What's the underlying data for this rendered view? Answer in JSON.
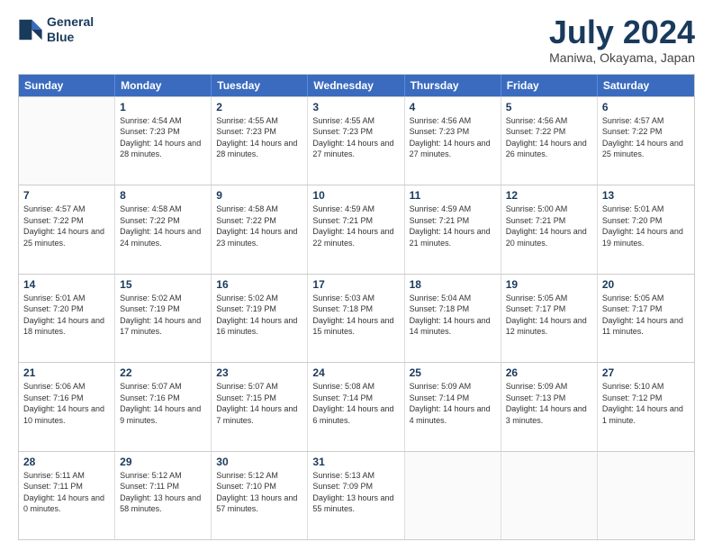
{
  "header": {
    "logo_line1": "General",
    "logo_line2": "Blue",
    "title": "July 2024",
    "subtitle": "Maniwa, Okayama, Japan"
  },
  "calendar": {
    "days": [
      "Sunday",
      "Monday",
      "Tuesday",
      "Wednesday",
      "Thursday",
      "Friday",
      "Saturday"
    ],
    "weeks": [
      [
        {
          "day": "",
          "sunrise": "",
          "sunset": "",
          "daylight": ""
        },
        {
          "day": "1",
          "sunrise": "Sunrise: 4:54 AM",
          "sunset": "Sunset: 7:23 PM",
          "daylight": "Daylight: 14 hours and 28 minutes."
        },
        {
          "day": "2",
          "sunrise": "Sunrise: 4:55 AM",
          "sunset": "Sunset: 7:23 PM",
          "daylight": "Daylight: 14 hours and 28 minutes."
        },
        {
          "day": "3",
          "sunrise": "Sunrise: 4:55 AM",
          "sunset": "Sunset: 7:23 PM",
          "daylight": "Daylight: 14 hours and 27 minutes."
        },
        {
          "day": "4",
          "sunrise": "Sunrise: 4:56 AM",
          "sunset": "Sunset: 7:23 PM",
          "daylight": "Daylight: 14 hours and 27 minutes."
        },
        {
          "day": "5",
          "sunrise": "Sunrise: 4:56 AM",
          "sunset": "Sunset: 7:22 PM",
          "daylight": "Daylight: 14 hours and 26 minutes."
        },
        {
          "day": "6",
          "sunrise": "Sunrise: 4:57 AM",
          "sunset": "Sunset: 7:22 PM",
          "daylight": "Daylight: 14 hours and 25 minutes."
        }
      ],
      [
        {
          "day": "7",
          "sunrise": "Sunrise: 4:57 AM",
          "sunset": "Sunset: 7:22 PM",
          "daylight": "Daylight: 14 hours and 25 minutes."
        },
        {
          "day": "8",
          "sunrise": "Sunrise: 4:58 AM",
          "sunset": "Sunset: 7:22 PM",
          "daylight": "Daylight: 14 hours and 24 minutes."
        },
        {
          "day": "9",
          "sunrise": "Sunrise: 4:58 AM",
          "sunset": "Sunset: 7:22 PM",
          "daylight": "Daylight: 14 hours and 23 minutes."
        },
        {
          "day": "10",
          "sunrise": "Sunrise: 4:59 AM",
          "sunset": "Sunset: 7:21 PM",
          "daylight": "Daylight: 14 hours and 22 minutes."
        },
        {
          "day": "11",
          "sunrise": "Sunrise: 4:59 AM",
          "sunset": "Sunset: 7:21 PM",
          "daylight": "Daylight: 14 hours and 21 minutes."
        },
        {
          "day": "12",
          "sunrise": "Sunrise: 5:00 AM",
          "sunset": "Sunset: 7:21 PM",
          "daylight": "Daylight: 14 hours and 20 minutes."
        },
        {
          "day": "13",
          "sunrise": "Sunrise: 5:01 AM",
          "sunset": "Sunset: 7:20 PM",
          "daylight": "Daylight: 14 hours and 19 minutes."
        }
      ],
      [
        {
          "day": "14",
          "sunrise": "Sunrise: 5:01 AM",
          "sunset": "Sunset: 7:20 PM",
          "daylight": "Daylight: 14 hours and 18 minutes."
        },
        {
          "day": "15",
          "sunrise": "Sunrise: 5:02 AM",
          "sunset": "Sunset: 7:19 PM",
          "daylight": "Daylight: 14 hours and 17 minutes."
        },
        {
          "day": "16",
          "sunrise": "Sunrise: 5:02 AM",
          "sunset": "Sunset: 7:19 PM",
          "daylight": "Daylight: 14 hours and 16 minutes."
        },
        {
          "day": "17",
          "sunrise": "Sunrise: 5:03 AM",
          "sunset": "Sunset: 7:18 PM",
          "daylight": "Daylight: 14 hours and 15 minutes."
        },
        {
          "day": "18",
          "sunrise": "Sunrise: 5:04 AM",
          "sunset": "Sunset: 7:18 PM",
          "daylight": "Daylight: 14 hours and 14 minutes."
        },
        {
          "day": "19",
          "sunrise": "Sunrise: 5:05 AM",
          "sunset": "Sunset: 7:17 PM",
          "daylight": "Daylight: 14 hours and 12 minutes."
        },
        {
          "day": "20",
          "sunrise": "Sunrise: 5:05 AM",
          "sunset": "Sunset: 7:17 PM",
          "daylight": "Daylight: 14 hours and 11 minutes."
        }
      ],
      [
        {
          "day": "21",
          "sunrise": "Sunrise: 5:06 AM",
          "sunset": "Sunset: 7:16 PM",
          "daylight": "Daylight: 14 hours and 10 minutes."
        },
        {
          "day": "22",
          "sunrise": "Sunrise: 5:07 AM",
          "sunset": "Sunset: 7:16 PM",
          "daylight": "Daylight: 14 hours and 9 minutes."
        },
        {
          "day": "23",
          "sunrise": "Sunrise: 5:07 AM",
          "sunset": "Sunset: 7:15 PM",
          "daylight": "Daylight: 14 hours and 7 minutes."
        },
        {
          "day": "24",
          "sunrise": "Sunrise: 5:08 AM",
          "sunset": "Sunset: 7:14 PM",
          "daylight": "Daylight: 14 hours and 6 minutes."
        },
        {
          "day": "25",
          "sunrise": "Sunrise: 5:09 AM",
          "sunset": "Sunset: 7:14 PM",
          "daylight": "Daylight: 14 hours and 4 minutes."
        },
        {
          "day": "26",
          "sunrise": "Sunrise: 5:09 AM",
          "sunset": "Sunset: 7:13 PM",
          "daylight": "Daylight: 14 hours and 3 minutes."
        },
        {
          "day": "27",
          "sunrise": "Sunrise: 5:10 AM",
          "sunset": "Sunset: 7:12 PM",
          "daylight": "Daylight: 14 hours and 1 minute."
        }
      ],
      [
        {
          "day": "28",
          "sunrise": "Sunrise: 5:11 AM",
          "sunset": "Sunset: 7:11 PM",
          "daylight": "Daylight: 14 hours and 0 minutes."
        },
        {
          "day": "29",
          "sunrise": "Sunrise: 5:12 AM",
          "sunset": "Sunset: 7:11 PM",
          "daylight": "Daylight: 13 hours and 58 minutes."
        },
        {
          "day": "30",
          "sunrise": "Sunrise: 5:12 AM",
          "sunset": "Sunset: 7:10 PM",
          "daylight": "Daylight: 13 hours and 57 minutes."
        },
        {
          "day": "31",
          "sunrise": "Sunrise: 5:13 AM",
          "sunset": "Sunset: 7:09 PM",
          "daylight": "Daylight: 13 hours and 55 minutes."
        },
        {
          "day": "",
          "sunrise": "",
          "sunset": "",
          "daylight": ""
        },
        {
          "day": "",
          "sunrise": "",
          "sunset": "",
          "daylight": ""
        },
        {
          "day": "",
          "sunrise": "",
          "sunset": "",
          "daylight": ""
        }
      ]
    ]
  }
}
